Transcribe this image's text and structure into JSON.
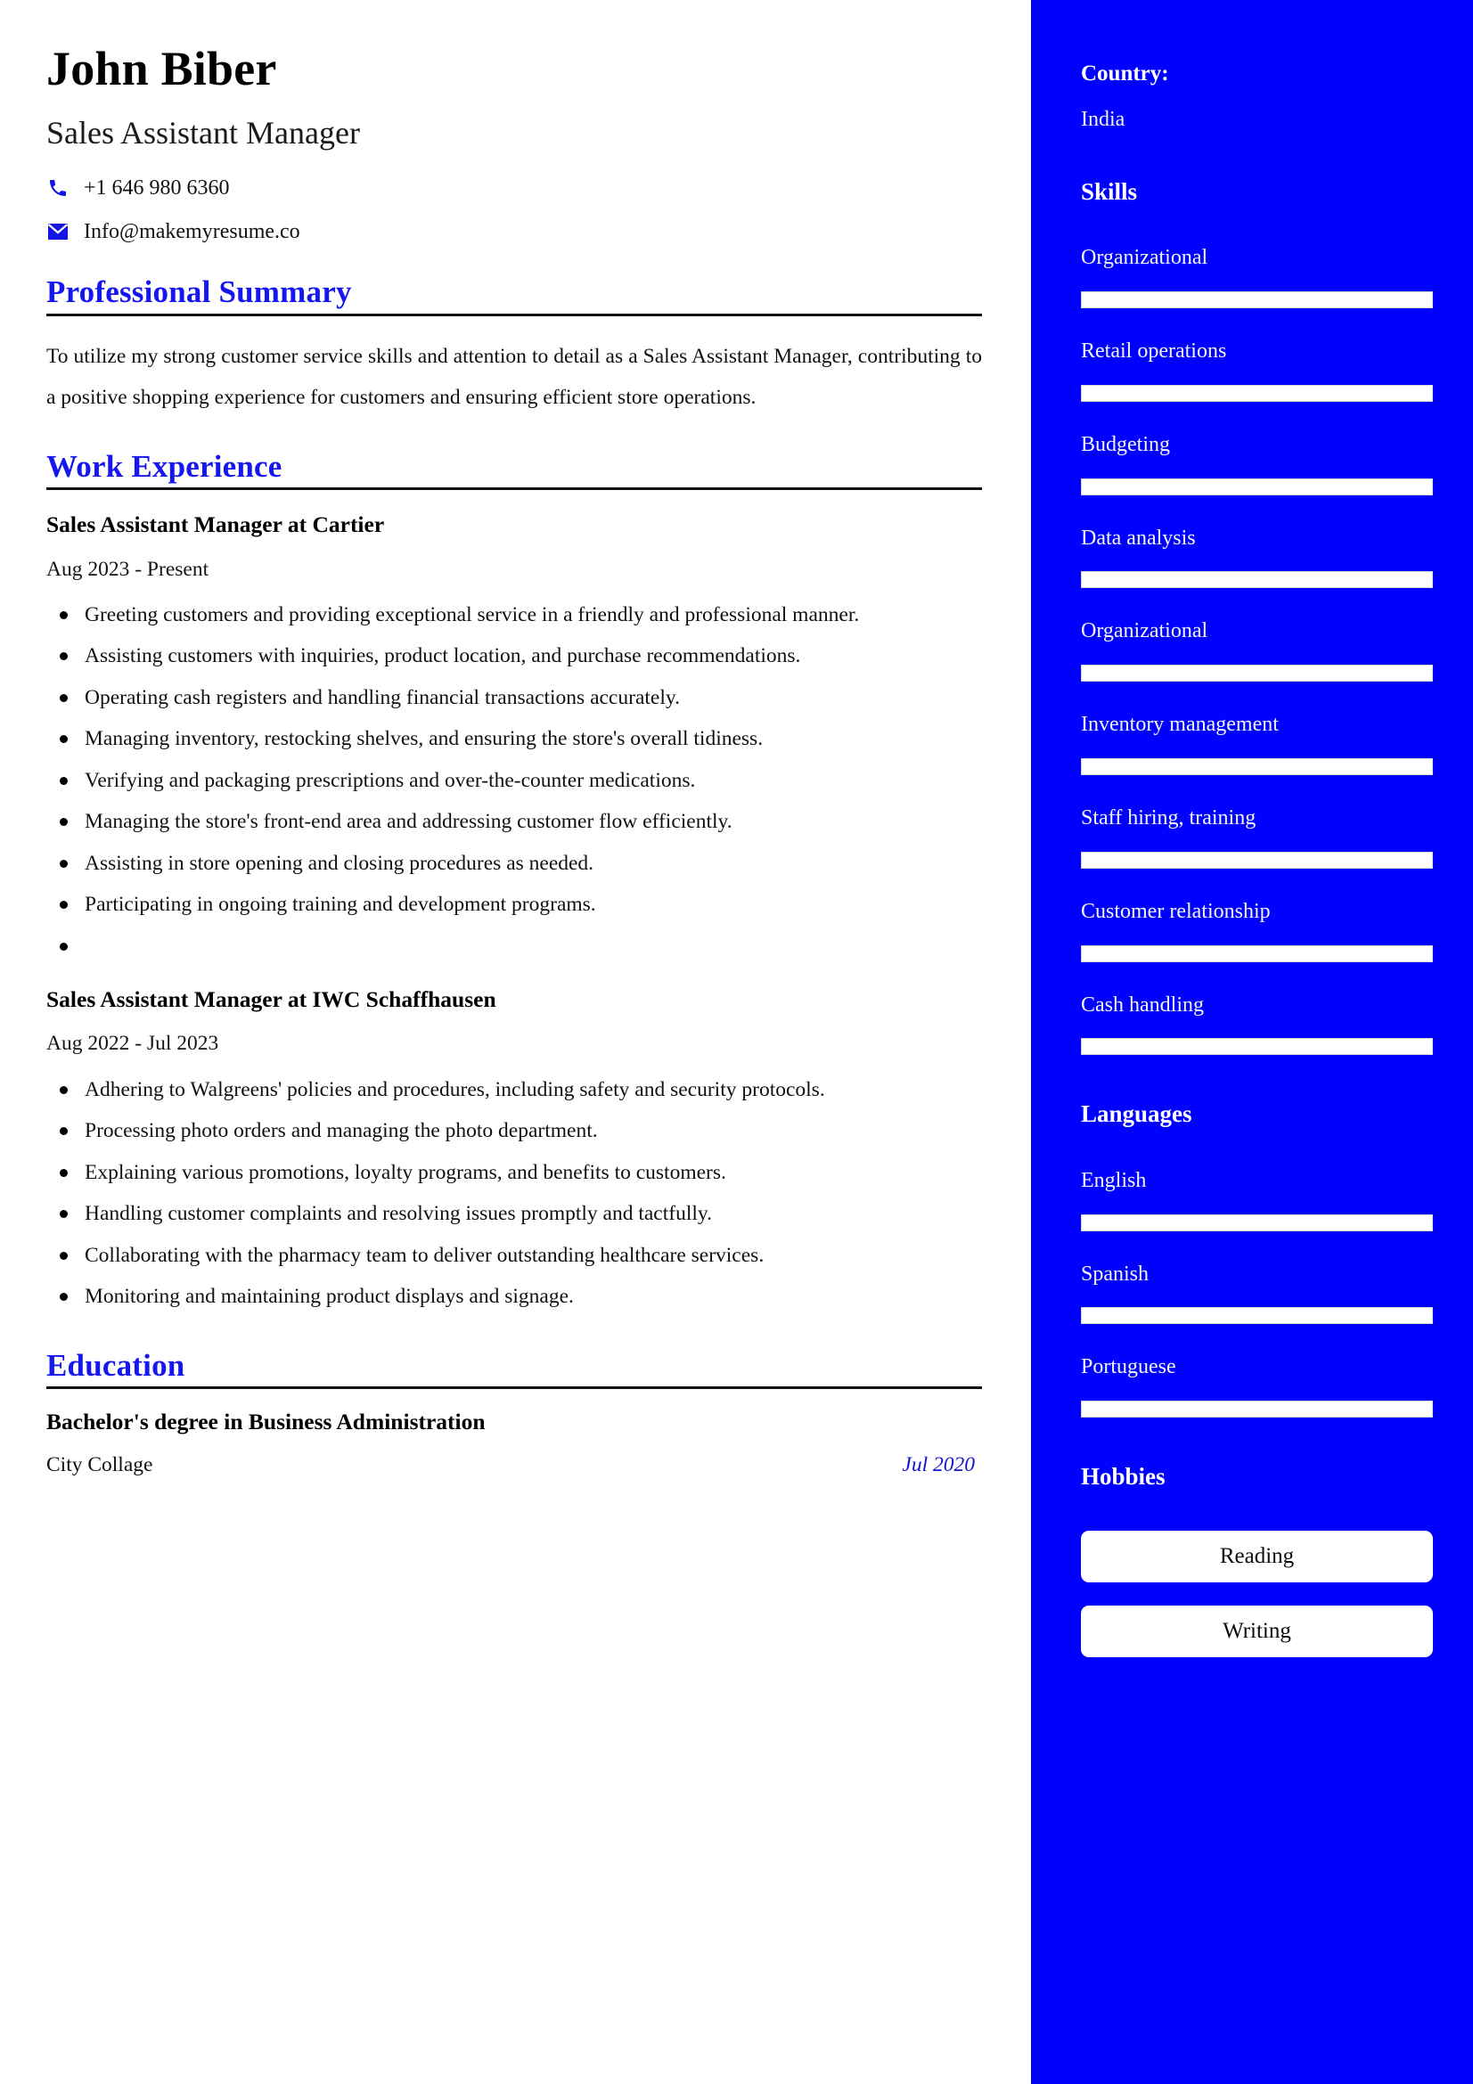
{
  "theme": {
    "accent_blue": "#0000FF",
    "heading_blue": "#1616F0",
    "sidebar_bg": "#0000FF",
    "page_bg": "#FFFFFF",
    "text_black": "#101010"
  },
  "header": {
    "name": "John Biber",
    "job_title": "Sales Assistant Manager",
    "phone": "+1 646 980 6360",
    "email": "Info@makemyresume.co",
    "phone_icon": "phone-icon",
    "email_icon": "envelope-icon"
  },
  "sections": {
    "summary_heading": "Professional Summary",
    "summary_text": "To utilize my strong customer service skills and attention to detail as a Sales Assistant Manager, contributing to a positive shopping experience for customers and ensuring efficient store operations.",
    "experience_heading": "Work Experience",
    "education_heading": "Education"
  },
  "experience": [
    {
      "title": "Sales Assistant Manager at Cartier",
      "dates": "Aug 2023 - Present",
      "bullets": [
        "Greeting customers and providing exceptional service in a friendly and professional manner.",
        "Assisting customers with inquiries, product location, and purchase recommendations.",
        "Operating cash registers and handling financial transactions accurately.",
        "Managing inventory, restocking shelves, and ensuring the store's overall tidiness.",
        "Verifying and packaging prescriptions and over-the-counter medications.",
        "Managing the store's front-end area and addressing customer flow efficiently.",
        "Assisting in store opening and closing procedures as needed.",
        "Participating in ongoing training and development programs.",
        ""
      ]
    },
    {
      "title": "Sales Assistant Manager at IWC Schaffhausen",
      "dates": "Aug 2022 - Jul 2023",
      "bullets": [
        "Adhering to Walgreens' policies and procedures, including safety and security protocols.",
        "Processing photo orders and managing the photo department.",
        "Explaining various promotions, loyalty programs, and benefits to customers.",
        "Handling customer complaints and resolving issues promptly and tactfully.",
        "Collaborating with the pharmacy team to deliver outstanding healthcare services.",
        "Monitoring and maintaining product displays and signage."
      ]
    }
  ],
  "education": [
    {
      "degree": "Bachelor's degree in Business Administration",
      "school": "City Collage",
      "date": "Jul 2020"
    }
  ],
  "sidebar": {
    "country_label": "Country:",
    "country_value": "India",
    "skills_heading": "Skills",
    "skills": [
      {
        "name": "Organizational",
        "level": 100
      },
      {
        "name": "Retail operations",
        "level": 100
      },
      {
        "name": "Budgeting",
        "level": 100
      },
      {
        "name": "Data analysis",
        "level": 100
      },
      {
        "name": "Organizational",
        "level": 100
      },
      {
        "name": "Inventory management",
        "level": 100
      },
      {
        "name": "Staff hiring, training",
        "level": 100
      },
      {
        "name": "Customer relationship",
        "level": 100
      },
      {
        "name": "Cash handling",
        "level": 100
      }
    ],
    "languages_heading": "Languages",
    "languages": [
      {
        "name": "English",
        "level": 100
      },
      {
        "name": "Spanish",
        "level": 100
      },
      {
        "name": "Portuguese",
        "level": 100
      }
    ],
    "hobbies_heading": "Hobbies",
    "hobbies": [
      "Reading",
      "Writing"
    ]
  }
}
